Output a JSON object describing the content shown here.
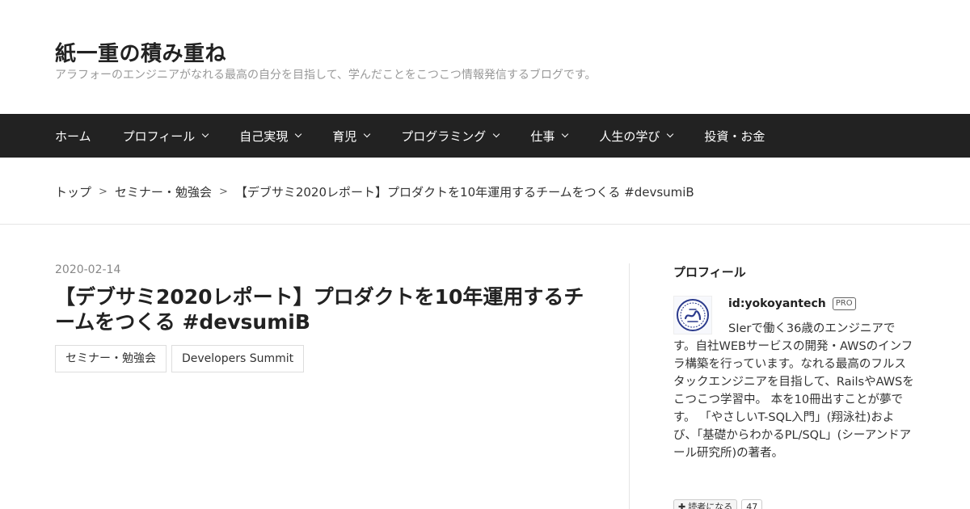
{
  "header": {
    "site_title": "紙一重の積み重ね",
    "site_description": "アラフォーのエンジニアがなれる最高の自分を目指して、学んだことをこつこつ情報発信するブログです。"
  },
  "nav": {
    "items": [
      {
        "label": "ホーム",
        "has_dropdown": false
      },
      {
        "label": "プロフィール",
        "has_dropdown": true
      },
      {
        "label": "自己実現",
        "has_dropdown": true
      },
      {
        "label": "育児",
        "has_dropdown": true
      },
      {
        "label": "プログラミング",
        "has_dropdown": true
      },
      {
        "label": "仕事",
        "has_dropdown": true
      },
      {
        "label": "人生の学び",
        "has_dropdown": true
      },
      {
        "label": "投資・お金",
        "has_dropdown": false
      }
    ]
  },
  "breadcrumb": {
    "top": "トップ",
    "category": "セミナー・勉強会",
    "separator": ">",
    "current": "【デブサミ2020レポート】プロダクトを10年運用するチームをつくる #devsumiB"
  },
  "entry": {
    "date": "2020-02-14",
    "title": "【デブサミ2020レポート】プロダクトを10年運用するチームをつくる #devsumiB",
    "categories": [
      "セミナー・勉強会",
      "Developers Summit"
    ]
  },
  "sidebar": {
    "title": "プロフィール",
    "profile_name": "id:yokoyantech",
    "pro_badge": "PRO",
    "profile_text": "SIerで働く36歳のエンジニアです。自社WEBサービスの開発・AWSのインフラ構築を行っています。なれる最高のフルスタックエンジニアを目指して、RailsやAWSをこつこつ学習中。 本を10冊出すことが夢です。 「やさしいT-SQL入門」(翔泳社)および、「基礎からわかるPL/SQL」(シーアンドアール研究所)の著者。",
    "subscribe_label": "読者になる",
    "subscriber_count": "47"
  },
  "colors": {
    "nav_background": "#222222",
    "nav_text": "#ffffff",
    "description_text": "#999999",
    "date_text": "#888888"
  }
}
